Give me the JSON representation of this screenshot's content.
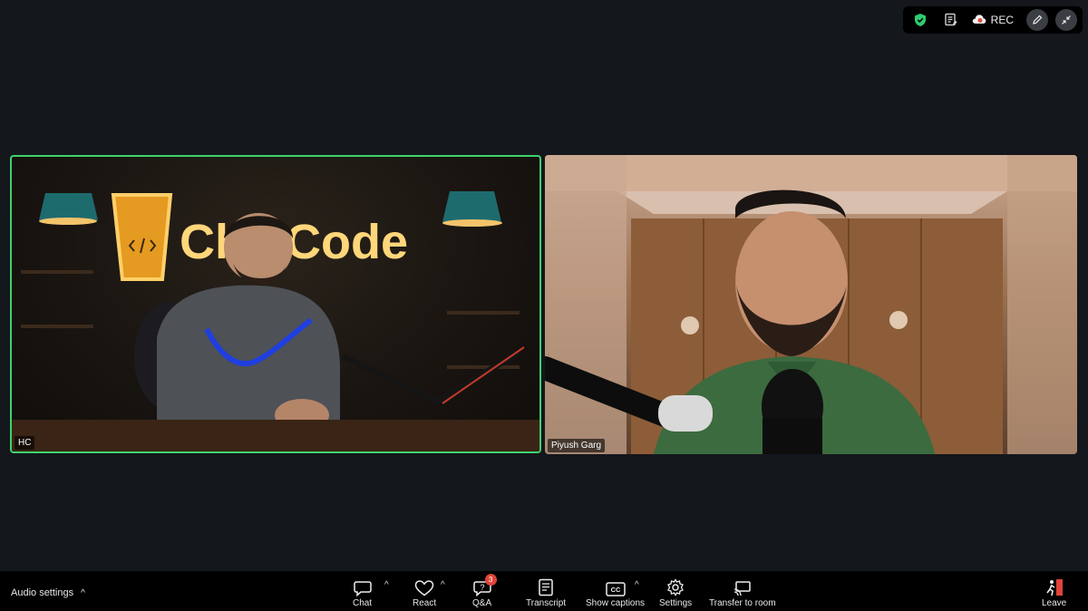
{
  "status_bar": {
    "rec_label": "REC",
    "icons": [
      "shield-icon",
      "notes-icon",
      "cloud-record-icon",
      "pencil-icon",
      "minimize-icon"
    ],
    "shield_color": "#2ecc71",
    "rec_color": "#e74c3c"
  },
  "participants": [
    {
      "name": "HC",
      "active_speaker": true,
      "sign_text": "ChaiCode"
    },
    {
      "name": "Piyush Garg",
      "active_speaker": false
    }
  ],
  "colors": {
    "active_border": "#3ed36c",
    "badge": "#e0443a"
  },
  "toolbar": {
    "audio_settings": "Audio settings",
    "chat": "Chat",
    "react": "React",
    "qa": "Q&A",
    "qa_badge": "3",
    "transcript": "Transcript",
    "show_captions": "Show captions",
    "settings": "Settings",
    "transfer": "Transfer to room",
    "leave": "Leave"
  }
}
